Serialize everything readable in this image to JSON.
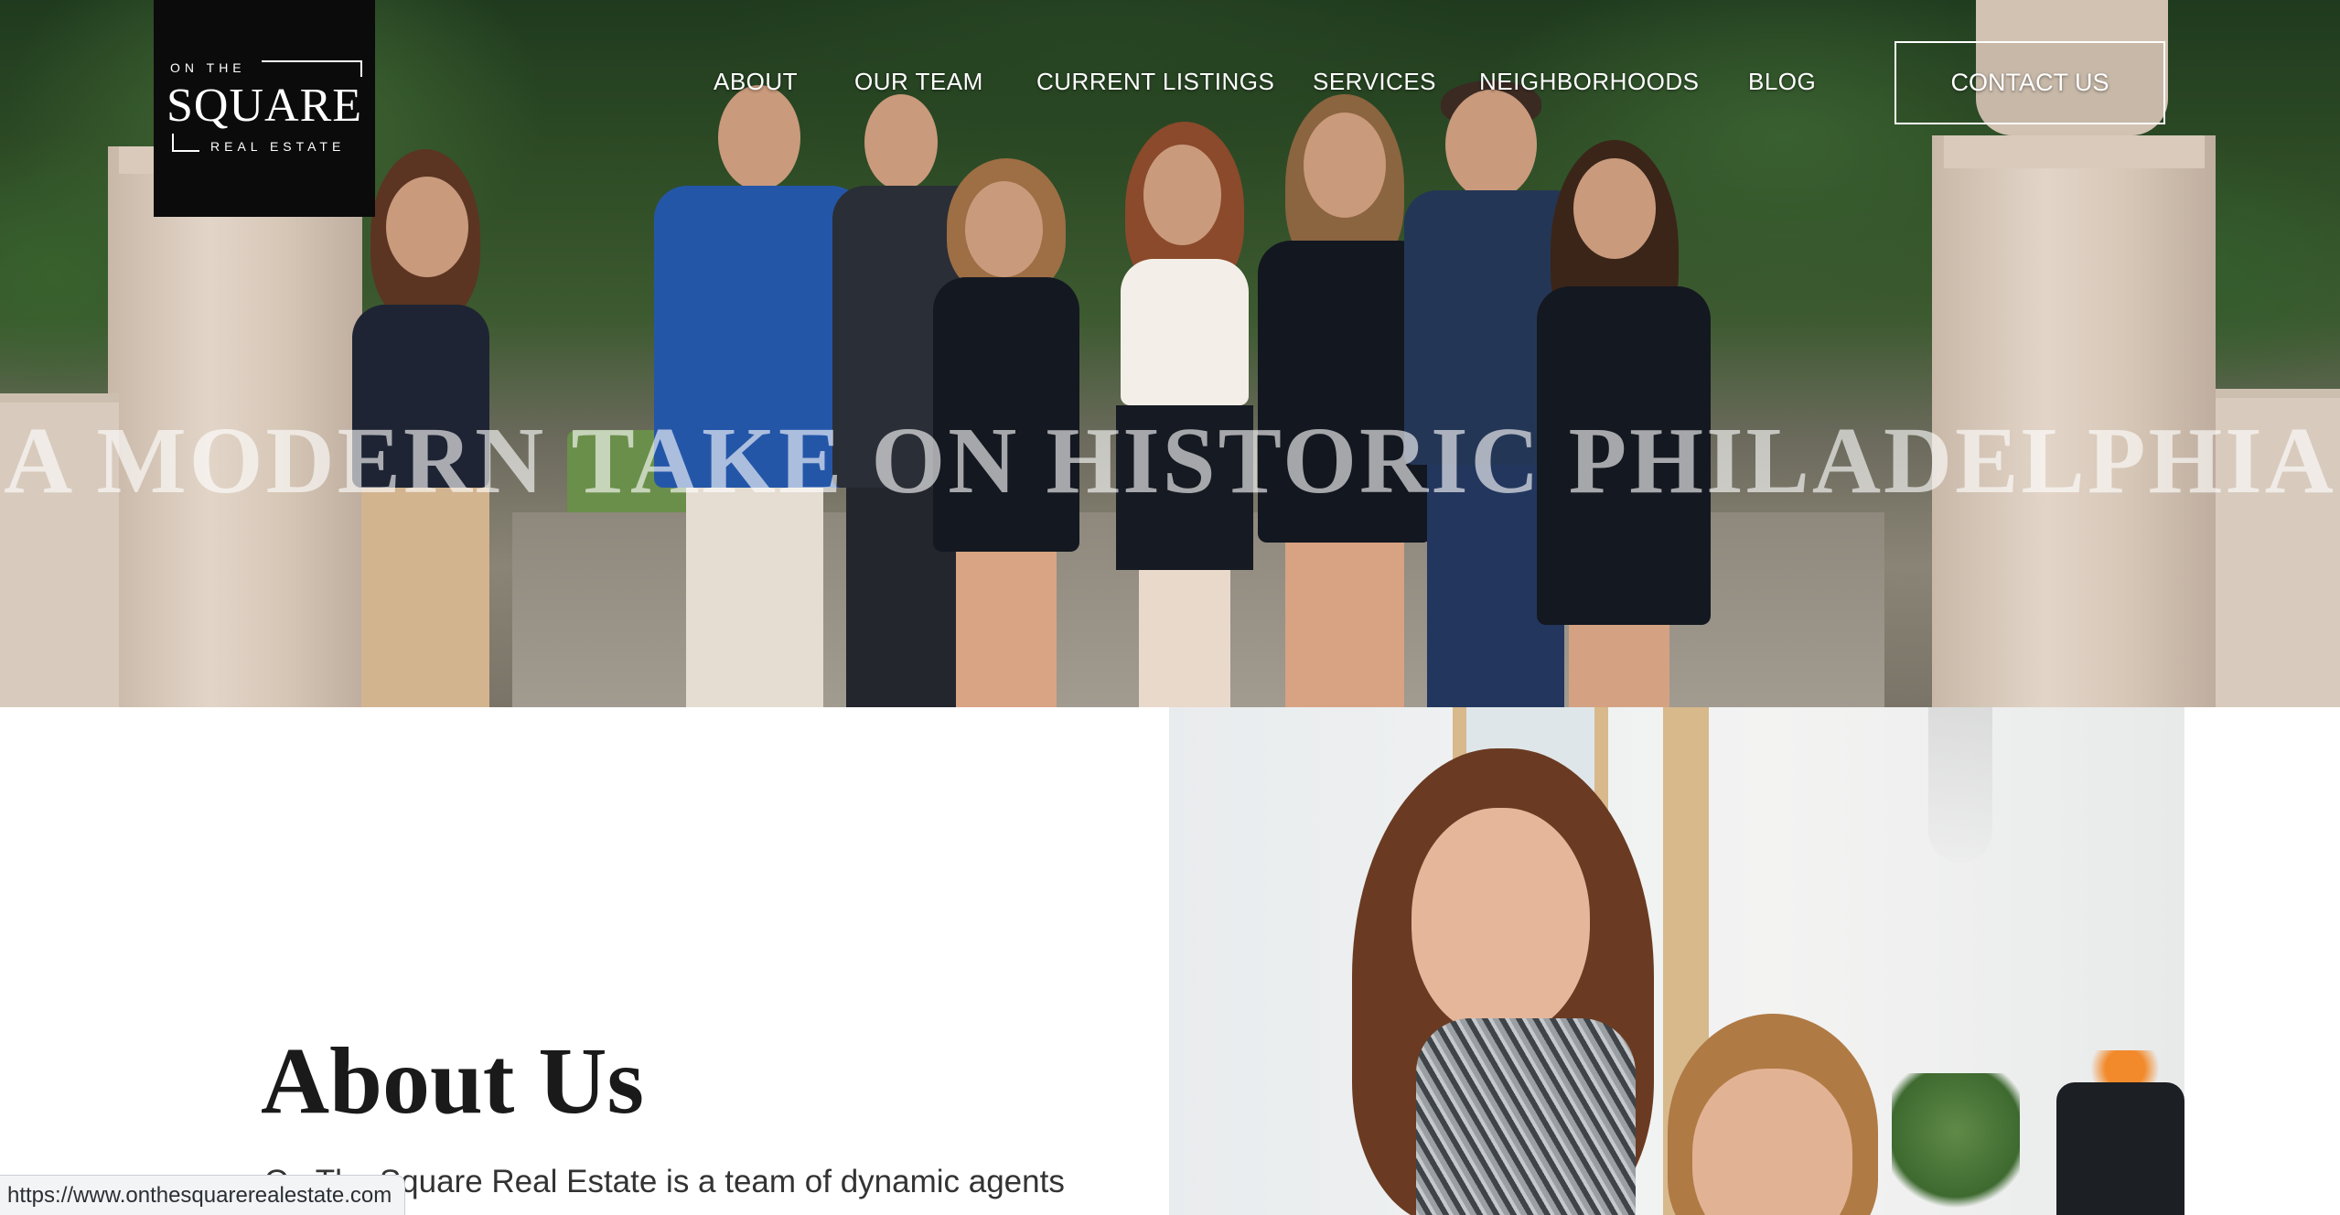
{
  "site": {
    "logo": {
      "line1": "ON THE",
      "line2": "SQUARE",
      "line3": "REAL ESTATE"
    },
    "nav": {
      "items": [
        {
          "label": "ABOUT"
        },
        {
          "label": "OUR TEAM"
        },
        {
          "label": "CURRENT LISTINGS"
        },
        {
          "label": "SERVICES"
        },
        {
          "label": "NEIGHBORHOODS"
        },
        {
          "label": "BLOG"
        }
      ],
      "contact_label": "CONTACT US"
    },
    "hero": {
      "tagline": "A MODERN TAKE ON HISTORIC PHILADELPHIA"
    },
    "about": {
      "title": "About Us",
      "text": "On The Square Real Estate is a team of dynamic agents"
    }
  },
  "browser": {
    "status_url": "https://www.onthesquarerealestate.com"
  },
  "colors": {
    "logo_bg": "#0b0b0b",
    "nav_text": "#ffffff",
    "heading": "#1a1a1a",
    "body_text": "#333333"
  }
}
